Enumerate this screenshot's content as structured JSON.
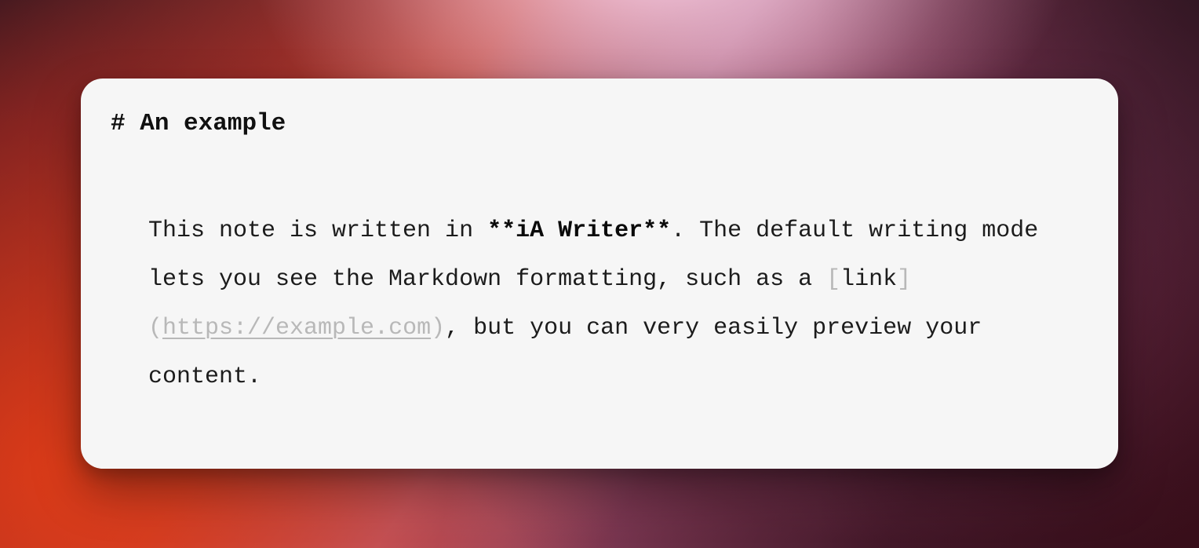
{
  "editor": {
    "heading_marker": "# ",
    "heading_text": "An example",
    "body": {
      "before_bold": "This note is written in ",
      "bold_marker_open": "**",
      "bold_text": "iA Writer",
      "bold_marker_close": "**",
      "after_bold": ". The default writing mode lets you see the Markdown formatting, such as a ",
      "link_bracket_open": "[",
      "link_text": "link",
      "link_bracket_close": "]",
      "link_paren_open": "(",
      "link_url": "https://example.com",
      "link_paren_close": ")",
      "after_link": ", but you can very easily preview your content."
    }
  }
}
